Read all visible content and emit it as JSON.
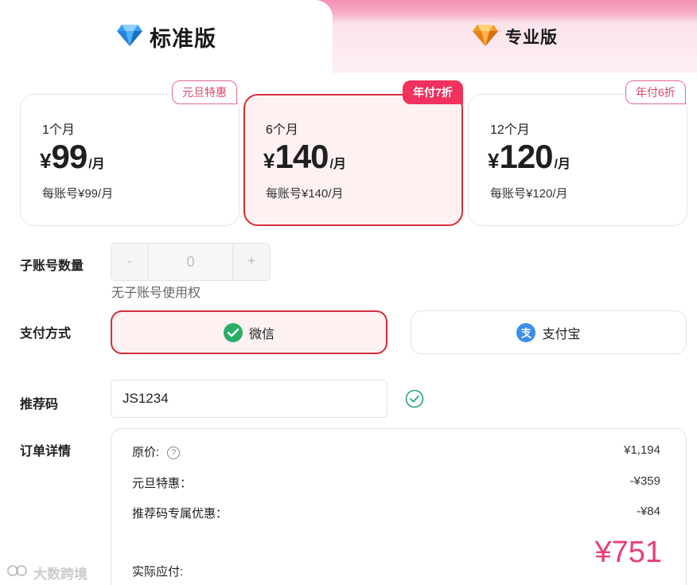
{
  "tabs": {
    "standard": {
      "label": "标准版",
      "icon": "diamond-icon"
    },
    "pro": {
      "label": "专业版",
      "icon": "gem-orange-icon"
    }
  },
  "plans": [
    {
      "period": "1个月",
      "yen": "¥",
      "amount": "99",
      "unit": "/月",
      "per_account": "每账号¥99/月",
      "badge": "元旦特惠",
      "selected": false
    },
    {
      "period": "6个月",
      "yen": "¥",
      "amount": "140",
      "unit": "/月",
      "per_account": "每账号¥140/月",
      "badge": "年付7折",
      "selected": true
    },
    {
      "period": "12个月",
      "yen": "¥",
      "amount": "120",
      "unit": "/月",
      "per_account": "每账号¥120/月",
      "badge": "年付6折",
      "selected": false
    }
  ],
  "sub_accounts": {
    "label": "子账号数量",
    "minus": "-",
    "value": "0",
    "plus": "+",
    "note": "无子账号使用权"
  },
  "payment": {
    "label": "支付方式",
    "wechat": "微信",
    "alipay": "支付宝",
    "selected": "wechat"
  },
  "referral": {
    "label": "推荐码",
    "value": "JS1234"
  },
  "order": {
    "label": "订单详情",
    "original_label": "原价:",
    "original_value": "¥1,194",
    "help_glyph": "?",
    "newyear_label": "元旦特惠：",
    "newyear_value": "-¥359",
    "referral_label": "推荐码专属优惠：",
    "referral_value": "-¥84",
    "total_label": "实际应付:",
    "total_value": "¥751"
  },
  "watermark": "大数跨境",
  "colors": {
    "accent_red": "#d72d3a",
    "badge_pink": "#f0325d",
    "total_pink": "#e83e7c",
    "wechat_green": "#2aae67",
    "alipay_blue": "#3d8ee8"
  }
}
